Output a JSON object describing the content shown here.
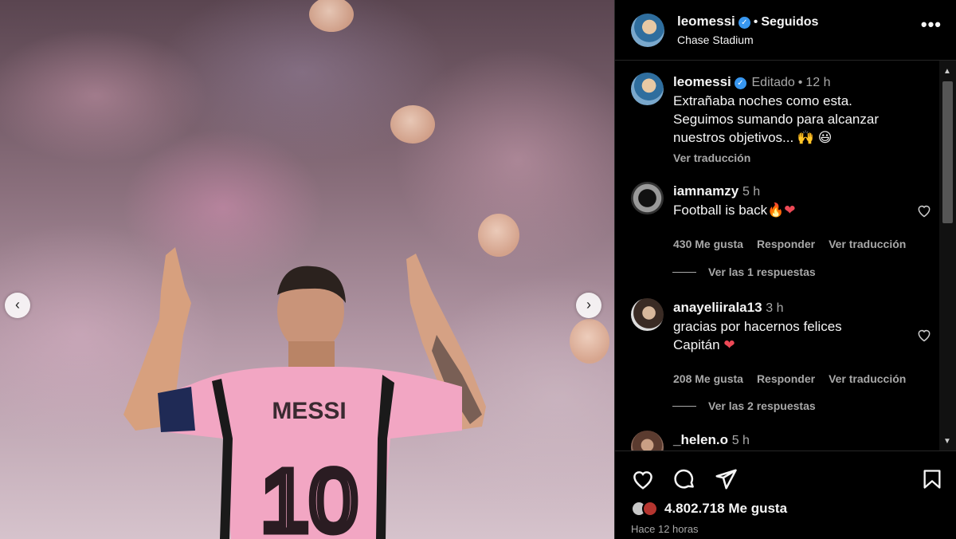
{
  "post": {
    "username": "leomessi",
    "follow_status": "Seguidos",
    "location": "Chase Stadium",
    "edited": "Editado",
    "age": "12 h",
    "caption_line1": "Extrañaba noches como esta.",
    "caption_line2": "Seguimos sumando para alcanzar",
    "caption_line3": "nuestros objetivos... 🙌 😃",
    "translate": "Ver traducción",
    "jersey_name": "MESSI",
    "jersey_number": "10"
  },
  "comments": [
    {
      "username": "iamnamzy",
      "age": "5 h",
      "text": "Football is back🔥",
      "heart": "❤",
      "likes": "430 Me gusta",
      "reply": "Responder",
      "translate": "Ver traducción",
      "replies": "Ver las 1 respuestas"
    },
    {
      "username": "anayeliirala13",
      "age": "3 h",
      "text_line1": "gracias por hacernos felices",
      "text_line2": "Capitán",
      "heart": "❤",
      "likes": "208 Me gusta",
      "reply": "Responder",
      "translate": "Ver traducción",
      "replies": "Ver las 2 respuestas"
    },
    {
      "username": "_helen.o",
      "age": "5 h"
    }
  ],
  "footer": {
    "likes": "4.802.718 Me gusta",
    "timestamp": "Hace 12 horas"
  },
  "icons": {
    "prev": "chevron-left-icon",
    "next": "chevron-right-icon",
    "more": "more-options-icon",
    "like": "heart-icon",
    "comment": "comment-icon",
    "share": "send-icon",
    "save": "bookmark-icon"
  },
  "colors": {
    "background": "#000000",
    "verified": "#3897f0",
    "secondary_text": "#a8a8a8",
    "jersey_pink": "#f2a6c3",
    "heart_red": "#ed4956"
  }
}
